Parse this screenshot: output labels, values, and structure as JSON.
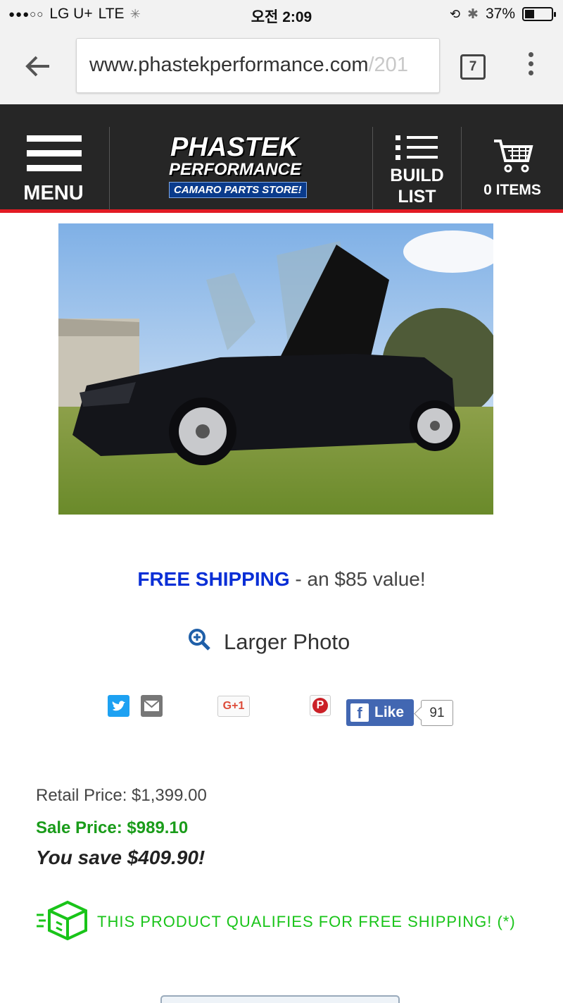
{
  "status_bar": {
    "carrier": "LG U+",
    "network": "LTE",
    "time": "오전 2:09",
    "battery": "37%",
    "battery_level": 0.37
  },
  "browser": {
    "url_main": "www.phastekperformance.com",
    "url_tail": "/201",
    "tab_count": "7"
  },
  "header": {
    "menu_label": "MENU",
    "logo": {
      "line1": "PHASTEK",
      "line2": "PERFORMANCE",
      "line3": "CAMARO PARTS STORE!"
    },
    "build_label_1": "BUILD",
    "build_label_2": "LIST",
    "cart_label": "0 ITEMS"
  },
  "product": {
    "free_shipping_highlight": "FREE SHIPPING",
    "free_shipping_rest": " - an $85 value!",
    "larger_photo": "Larger Photo"
  },
  "social": {
    "gplus_label": "G+1",
    "like_label": "Like",
    "like_count": "91"
  },
  "pricing": {
    "retail": "Retail Price: $1,399.00",
    "sale": "Sale Price: $989.10",
    "save": "You save $409.90!"
  },
  "shipping_note": "THIS PRODUCT QUALIFIES FOR FREE SHIPPING! (*)",
  "colors": {
    "header_bg": "#262626",
    "accent_red": "#e21b23",
    "link_blue": "#0a2fd6",
    "sale_green": "#1a9c1a",
    "ship_green": "#19c419"
  }
}
